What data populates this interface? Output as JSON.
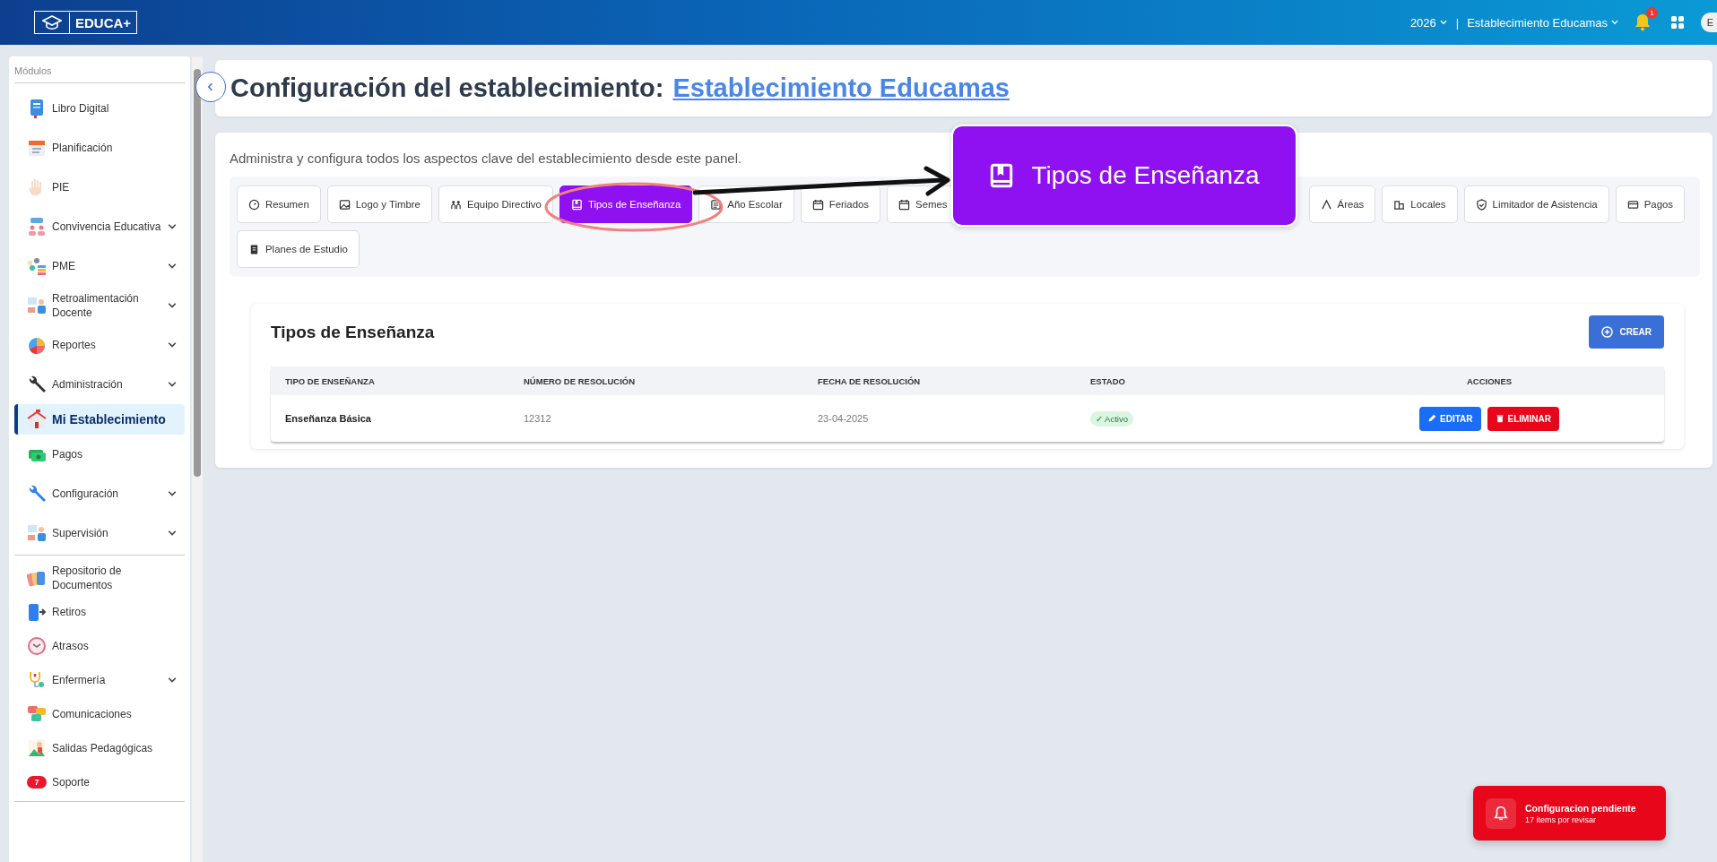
{
  "topbar": {
    "logo": "EDUCA+",
    "year": "2026",
    "separator": "|",
    "school": "Establecimiento Educamas",
    "notifications": "1",
    "avatar": "E"
  },
  "sidebar": {
    "sections": [
      {
        "label": "Módulos",
        "items": [
          {
            "label": "Libro Digital",
            "expandable": false,
            "selected": false
          },
          {
            "label": "Planificación",
            "expandable": false,
            "selected": false
          },
          {
            "label": "PIE",
            "expandable": false,
            "selected": false
          },
          {
            "label": "Convivencia Educativa",
            "expandable": true,
            "expanded": false,
            "selected": false
          },
          {
            "label": "PME",
            "expandable": true,
            "expanded": false,
            "selected": false
          },
          {
            "label": "Retroalimentación Docente",
            "expandable": true,
            "expanded": false,
            "selected": false
          },
          {
            "label": "Reportes",
            "expandable": true,
            "expanded": false,
            "selected": false
          },
          {
            "label": "Administración",
            "expandable": true,
            "expanded": false,
            "selected": false
          },
          {
            "label": "Mi Establecimiento",
            "expandable": false,
            "selected": true
          },
          {
            "label": "Pagos",
            "expandable": false,
            "selected": false
          },
          {
            "label": "Configuración",
            "expandable": true,
            "expanded": false,
            "selected": false
          },
          {
            "label": "Supervisión",
            "expandable": true,
            "expanded": false,
            "selected": false
          }
        ]
      },
      {
        "items": [
          {
            "label": "Repositorio de Documentos",
            "expandable": false,
            "selected": false
          },
          {
            "label": "Retiros",
            "expandable": false,
            "selected": false
          },
          {
            "label": "Atrasos",
            "expandable": false,
            "selected": false
          },
          {
            "label": "Enfermería",
            "expandable": true,
            "expanded": false,
            "selected": false
          },
          {
            "label": "Comunicaciones",
            "expandable": false,
            "selected": false
          },
          {
            "label": "Salidas Pedagógicas",
            "expandable": false,
            "selected": false
          },
          {
            "label": "Soporte",
            "expandable": false,
            "selected": false,
            "badge": "7"
          }
        ]
      }
    ]
  },
  "header": {
    "title": "Configuración del establecimiento:",
    "link": "Establecimiento Educamas"
  },
  "panel": {
    "description": "Administra y configura todos los aspectos clave del establecimiento desde este panel.",
    "tabs": [
      {
        "label": "Resumen",
        "selected": false
      },
      {
        "label": "Logo y Timbre",
        "selected": false
      },
      {
        "label": "Equipo Directivo",
        "selected": false
      },
      {
        "label": "Tipos de Enseñanza",
        "selected": true
      },
      {
        "label": "Año Escolar",
        "selected": false
      },
      {
        "label": "Feriados",
        "selected": false
      },
      {
        "label": "Semes",
        "selected": false,
        "covered": true
      },
      {
        "label": "Áreas",
        "selected": false
      },
      {
        "label": "Locales",
        "selected": false
      },
      {
        "label": "Limitador de Asistencia",
        "selected": false
      },
      {
        "label": "Pagos",
        "selected": false
      },
      {
        "label": "Planes de Estudio",
        "selected": false
      }
    ],
    "callout": "Tipos de Enseñanza"
  },
  "section": {
    "title": "Tipos de Enseñanza",
    "create_button": "CREAR",
    "table": {
      "columns": [
        "TIPO DE ENSEÑANZA",
        "NÚMERO DE RESOLUCIÓN",
        "FECHA DE RESOLUCIÓN",
        "ESTADO",
        "ACCIONES"
      ],
      "rows": [
        {
          "type": "Enseñanza Básica",
          "resolution": "12312",
          "date": "23-04-2025",
          "status": "✓ Activo",
          "active": true,
          "edit": "EDITAR",
          "delete": "ELIMINAR"
        }
      ]
    }
  },
  "toast": {
    "title": "Configuracion pendiente",
    "subtitle": "17 items por revisar"
  }
}
